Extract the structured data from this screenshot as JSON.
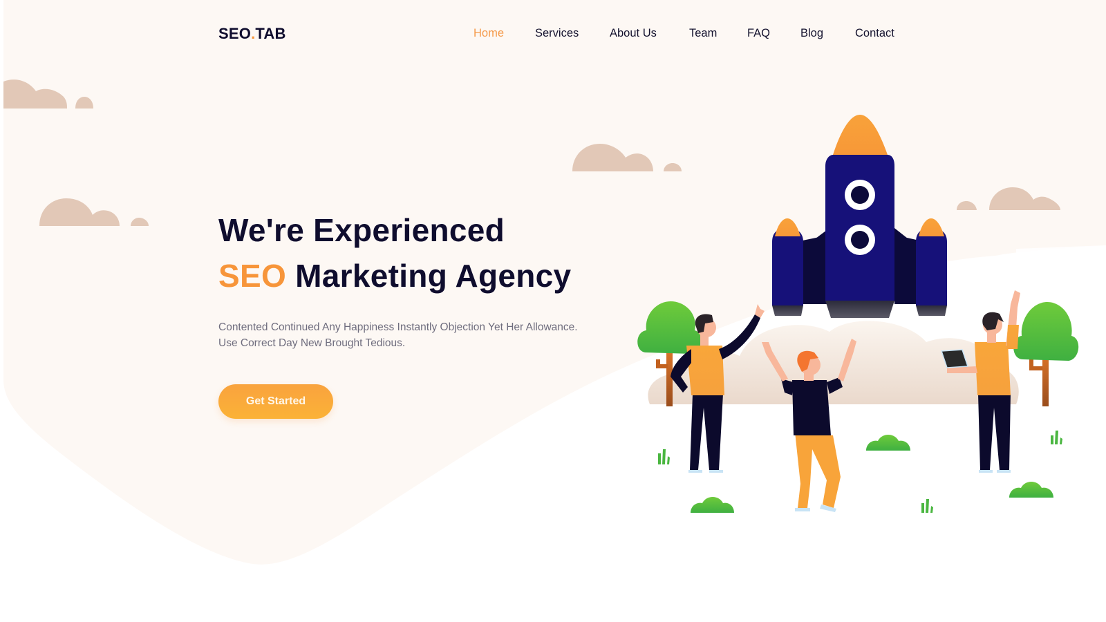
{
  "brand": {
    "logo_left": "SEO",
    "logo_dot": ".",
    "logo_right": "TAB"
  },
  "nav": {
    "items": [
      {
        "label": "Home",
        "active": true
      },
      {
        "label": "Services",
        "active": false
      },
      {
        "label": "About Us",
        "active": false
      },
      {
        "label": "Team",
        "active": false
      },
      {
        "label": "FAQ",
        "active": false
      },
      {
        "label": "Blog",
        "active": false
      },
      {
        "label": "Contact",
        "active": false
      }
    ]
  },
  "hero": {
    "title_line1": "We're Experienced",
    "title_accent": "SEO",
    "title_line2_rest": " Marketing Agency",
    "subtitle_line1": "Contented Continued Any Happiness Instantly Objection Yet Her Allowance.",
    "subtitle_line2": "Use Correct Day New Brought Tedious.",
    "cta_label": "Get Started"
  },
  "colors": {
    "accent": "#f7953a",
    "dark": "#0f0d2e",
    "rocket_body": "#161179",
    "background_tint": "#fdf8f4",
    "cloud": "#e2c8b7",
    "tree_green": "#5fc23c"
  },
  "illustration": {
    "description": "rocket-launch-with-three-people"
  }
}
